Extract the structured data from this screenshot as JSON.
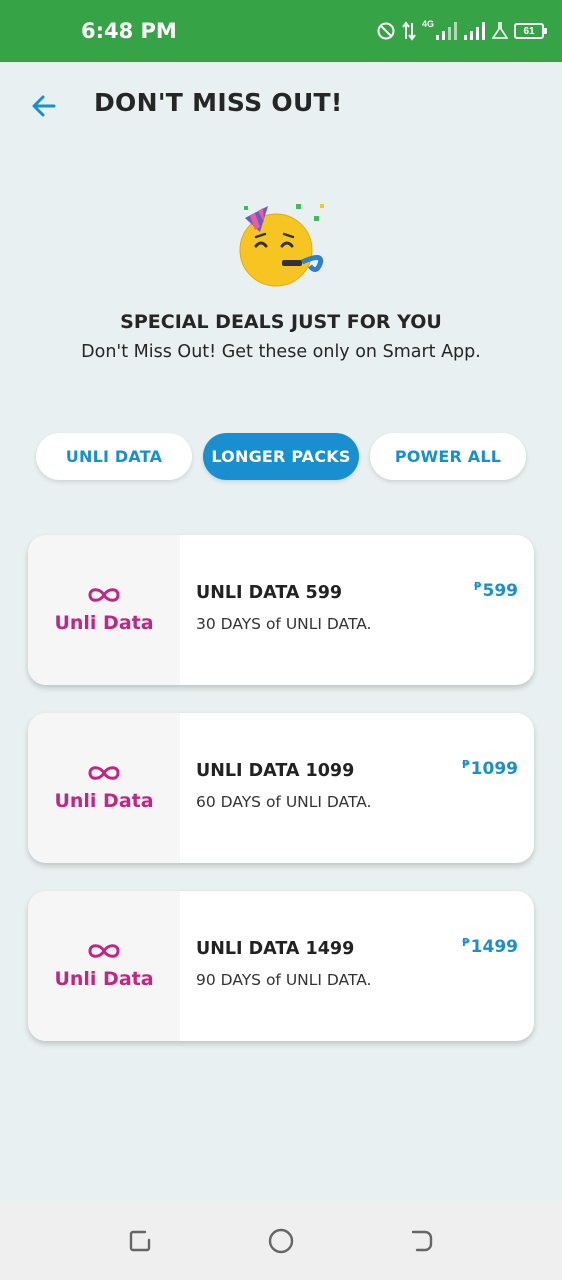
{
  "status_bar": {
    "time": "6:48 PM",
    "network": "4G",
    "battery": "61",
    "background": "#36a346"
  },
  "header": {
    "title": "DON'T MISS OUT!"
  },
  "hero": {
    "heading": "SPECIAL DEALS JUST FOR YOU",
    "subheading": "Don't Miss Out! Get these only on Smart App."
  },
  "tabs": [
    {
      "label": "UNLI DATA",
      "active": false
    },
    {
      "label": "LONGER PACKS",
      "active": true
    },
    {
      "label": "POWER ALL",
      "active": false
    }
  ],
  "offers": [
    {
      "logo": "Unli Data",
      "name": "UNLI DATA 599",
      "description": "30 DAYS of UNLI DATA.",
      "currency": "₱",
      "price": "599"
    },
    {
      "logo": "Unli Data",
      "name": "UNLI DATA 1099",
      "description": "60 DAYS of UNLI DATA.",
      "currency": "₱",
      "price": "1099"
    },
    {
      "logo": "Unli Data",
      "name": "UNLI DATA 1499",
      "description": "90 DAYS of UNLI DATA.",
      "currency": "₱",
      "price": "1499"
    }
  ],
  "colors": {
    "accent": "#1a8fcf",
    "brand_magenta": "#c02684",
    "page_background": "#e8f0f1"
  },
  "icons": {
    "back": "arrow-left-icon",
    "hero": "party-face-emoji",
    "logo": "infinity-icon",
    "nav": [
      "recents-icon",
      "home-icon",
      "back-nav-icon"
    ]
  }
}
